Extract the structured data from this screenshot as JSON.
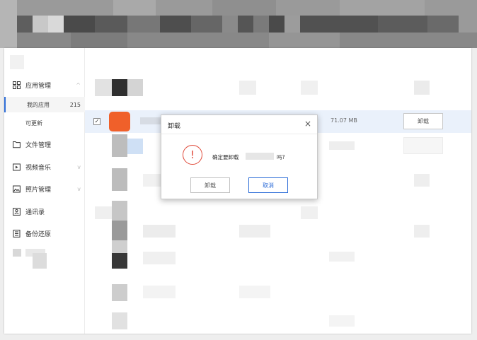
{
  "sidebar": {
    "nav_app_manage": "应用管理",
    "sub_my_apps": "我的应用",
    "sub_my_apps_count": "215",
    "sub_updatable": "可更新",
    "nav_file_manage": "文件管理",
    "nav_video_music": "视频音乐",
    "nav_photo_manage": "照片管理",
    "nav_contacts": "通讯录",
    "nav_backup": "备份还原"
  },
  "list": {
    "selected_row": {
      "checked_mark": "✓",
      "size": "71.07 MB",
      "uninstall_label": "卸载"
    }
  },
  "dialog": {
    "title": "卸载",
    "close_glyph": "×",
    "message_prefix": "确定要卸载",
    "message_suffix": "吗?",
    "warning_glyph": "!",
    "ok_label": "卸载",
    "cancel_label": "取消"
  },
  "colors": {
    "accent": "#2f6ed8",
    "warning": "#e04a3a",
    "app_icon": "#f0602a",
    "selected_row": "#eaf1fb"
  },
  "icons": [
    "grid-icon",
    "folder-icon",
    "video-icon",
    "image-icon",
    "contacts-icon",
    "backup-icon",
    "warning-icon",
    "close-icon",
    "chevron-icon"
  ]
}
